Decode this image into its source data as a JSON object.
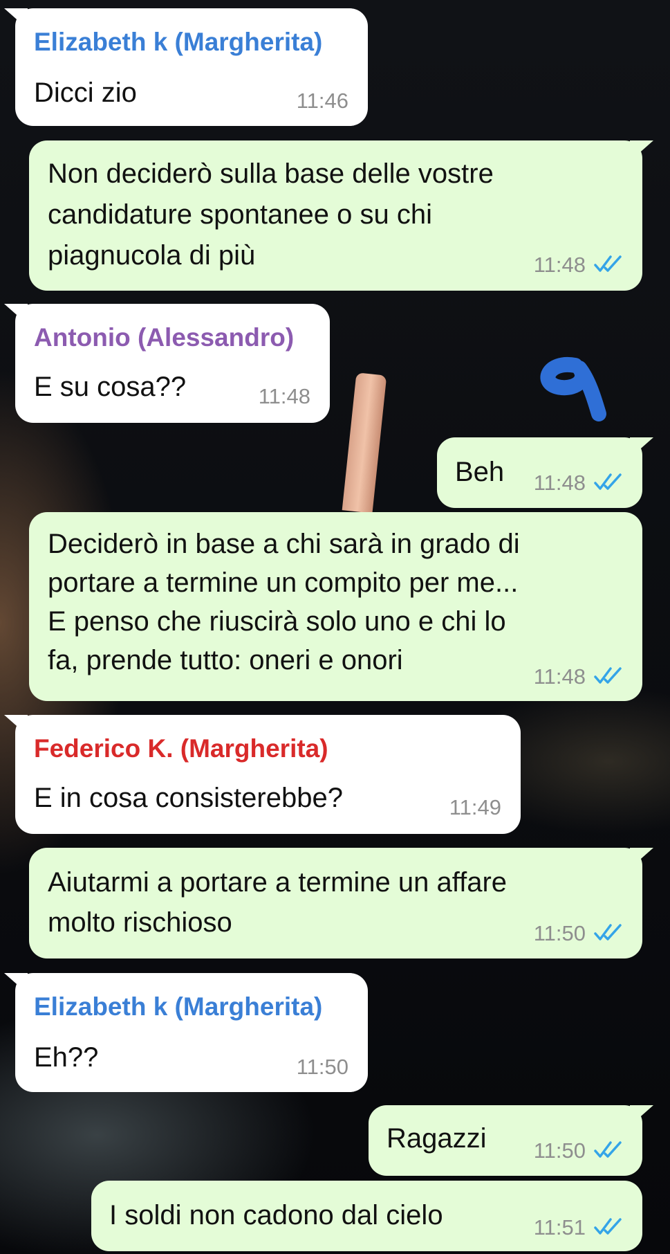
{
  "colors": {
    "sender_elizabeth": "#3a7fd6",
    "sender_antonio": "#8c5bb0",
    "sender_federico": "#d92a2a",
    "outgoing_bubble": "#e4fcd7",
    "incoming_bubble": "#ffffff",
    "read_ticks": "#34a4e8"
  },
  "messages": [
    {
      "direction": "in",
      "sender": "Elizabeth k (Margherita)",
      "lines": [
        "Dicci zio"
      ],
      "time": "11:46"
    },
    {
      "direction": "out",
      "lines": [
        "Non deciderò sulla base delle vostre",
        "candidature spontanee o su chi",
        "piagnucola di più"
      ],
      "time": "11:48",
      "status_icon": "double-check-read"
    },
    {
      "direction": "in",
      "sender": "Antonio (Alessandro)",
      "lines": [
        "E su cosa??"
      ],
      "time": "11:48"
    },
    {
      "direction": "out",
      "lines": [
        "Beh"
      ],
      "time": "11:48",
      "status_icon": "double-check-read"
    },
    {
      "direction": "out",
      "lines": [
        "Deciderò in base a chi sarà in grado di",
        "portare a termine un compito per me...",
        "E penso che riuscirà solo uno e chi lo",
        "fa, prende tutto: oneri e onori"
      ],
      "time": "11:48",
      "status_icon": "double-check-read"
    },
    {
      "direction": "in",
      "sender": "Federico K. (Margherita)",
      "lines": [
        "E in cosa consisterebbe?"
      ],
      "time": "11:49"
    },
    {
      "direction": "out",
      "lines": [
        "Aiutarmi a portare a termine un affare",
        "molto rischioso"
      ],
      "time": "11:50",
      "status_icon": "double-check-read"
    },
    {
      "direction": "in",
      "sender": "Elizabeth k (Margherita)",
      "lines": [
        "Eh??"
      ],
      "time": "11:50"
    },
    {
      "direction": "out",
      "lines": [
        "Ragazzi"
      ],
      "time": "11:50",
      "status_icon": "double-check-read"
    },
    {
      "direction": "out",
      "lines": [
        "I soldi non cadono dal cielo"
      ],
      "time": "11:51",
      "status_icon": "double-check-read"
    }
  ]
}
